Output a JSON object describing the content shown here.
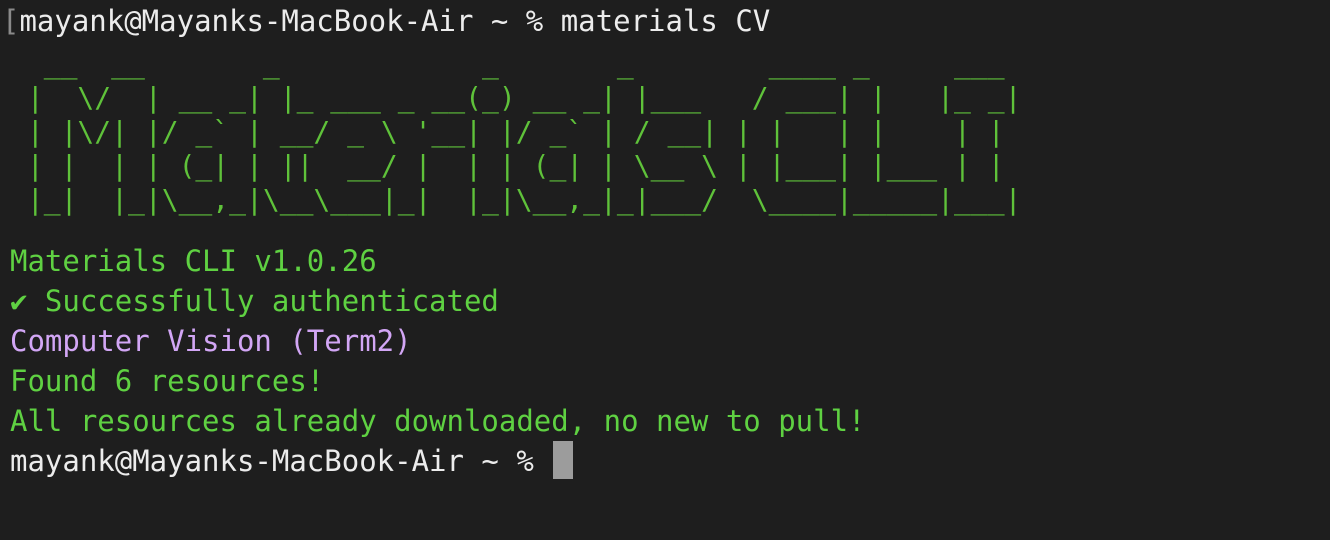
{
  "terminal": {
    "first_prompt": "mayank@Mayanks-MacBook-Air ~ % ",
    "first_command": "materials CV",
    "banner_lines": [
      "  __  __       _            _       _        ____ _     ___ ",
      " |  \\/  | __ _| |_ ___ _ __(_) __ _| |___   / ___| |   |_ _|",
      " | |\\/| |/ _` | __/ _ \\ '__| |/ _` | / __| | |   | |    | | ",
      " | |  | | (_| | ||  __/ |  | | (_| | \\__ \\ | |___| |___ | | ",
      " |_|  |_|\\__,_|\\__\\___|_|  |_|\\__,_|_|___/  \\____|_____|___|"
    ],
    "version_line": "Materials CLI v1.0.26",
    "auth_line": "✔ Successfully authenticated",
    "project_line": "Computer Vision (Term2)",
    "found_line": "Found 6 resources!",
    "status_line": "All resources already downloaded, no new to pull!",
    "final_prompt": "mayank@Mayanks-MacBook-Air ~ % "
  },
  "colors": {
    "background": "#1e1e1e",
    "green": "#5fd142",
    "purple": "#d2a6f5",
    "foreground": "#ececec",
    "cursor": "#9c9c9c"
  }
}
